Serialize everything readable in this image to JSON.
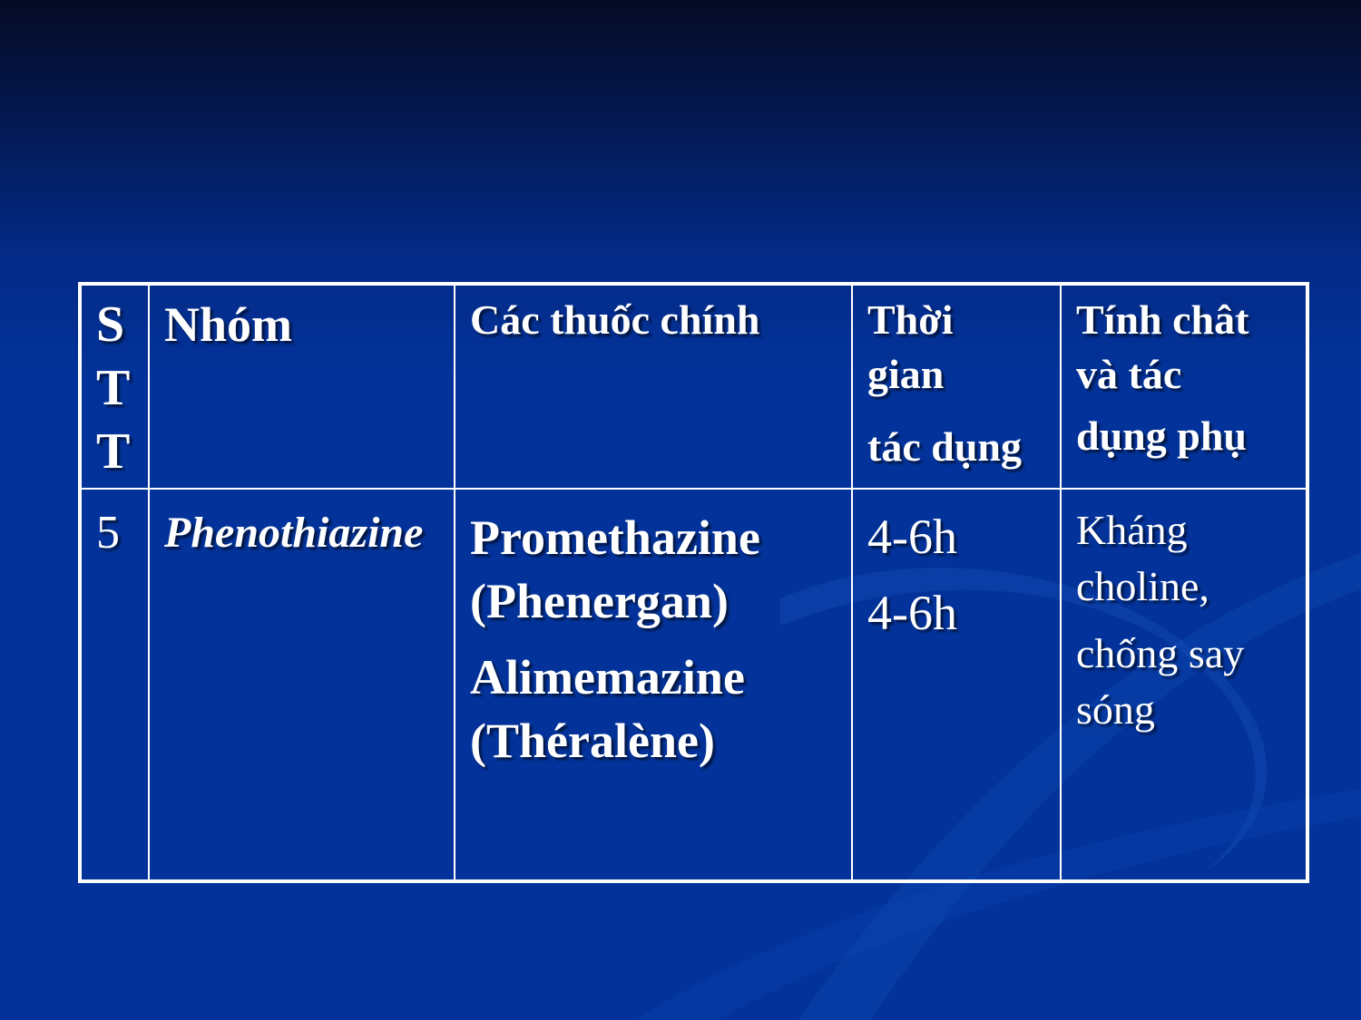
{
  "table": {
    "headers": {
      "stt": [
        "S",
        "T",
        "T"
      ],
      "group": "Nhóm",
      "drugs": "Các thuốc chính",
      "duration": [
        "Thời",
        "gian",
        "tác dụng"
      ],
      "properties": [
        "Tính chât",
        "và tác",
        "dụng phụ"
      ]
    },
    "rows": [
      {
        "stt": "5",
        "group": "Phenothiazine",
        "drugs": [
          "Promethazine",
          "(Phenergan)",
          "Alimemazine",
          "(Théralène)"
        ],
        "durations": [
          "4-6h",
          "4-6h"
        ],
        "properties": [
          "Kháng",
          "choline,",
          "chống say",
          "sóng"
        ]
      }
    ]
  },
  "colors": {
    "background": "#03339a",
    "background_top": "#050b25",
    "border": "#ffffff",
    "text": "#ffffff"
  }
}
